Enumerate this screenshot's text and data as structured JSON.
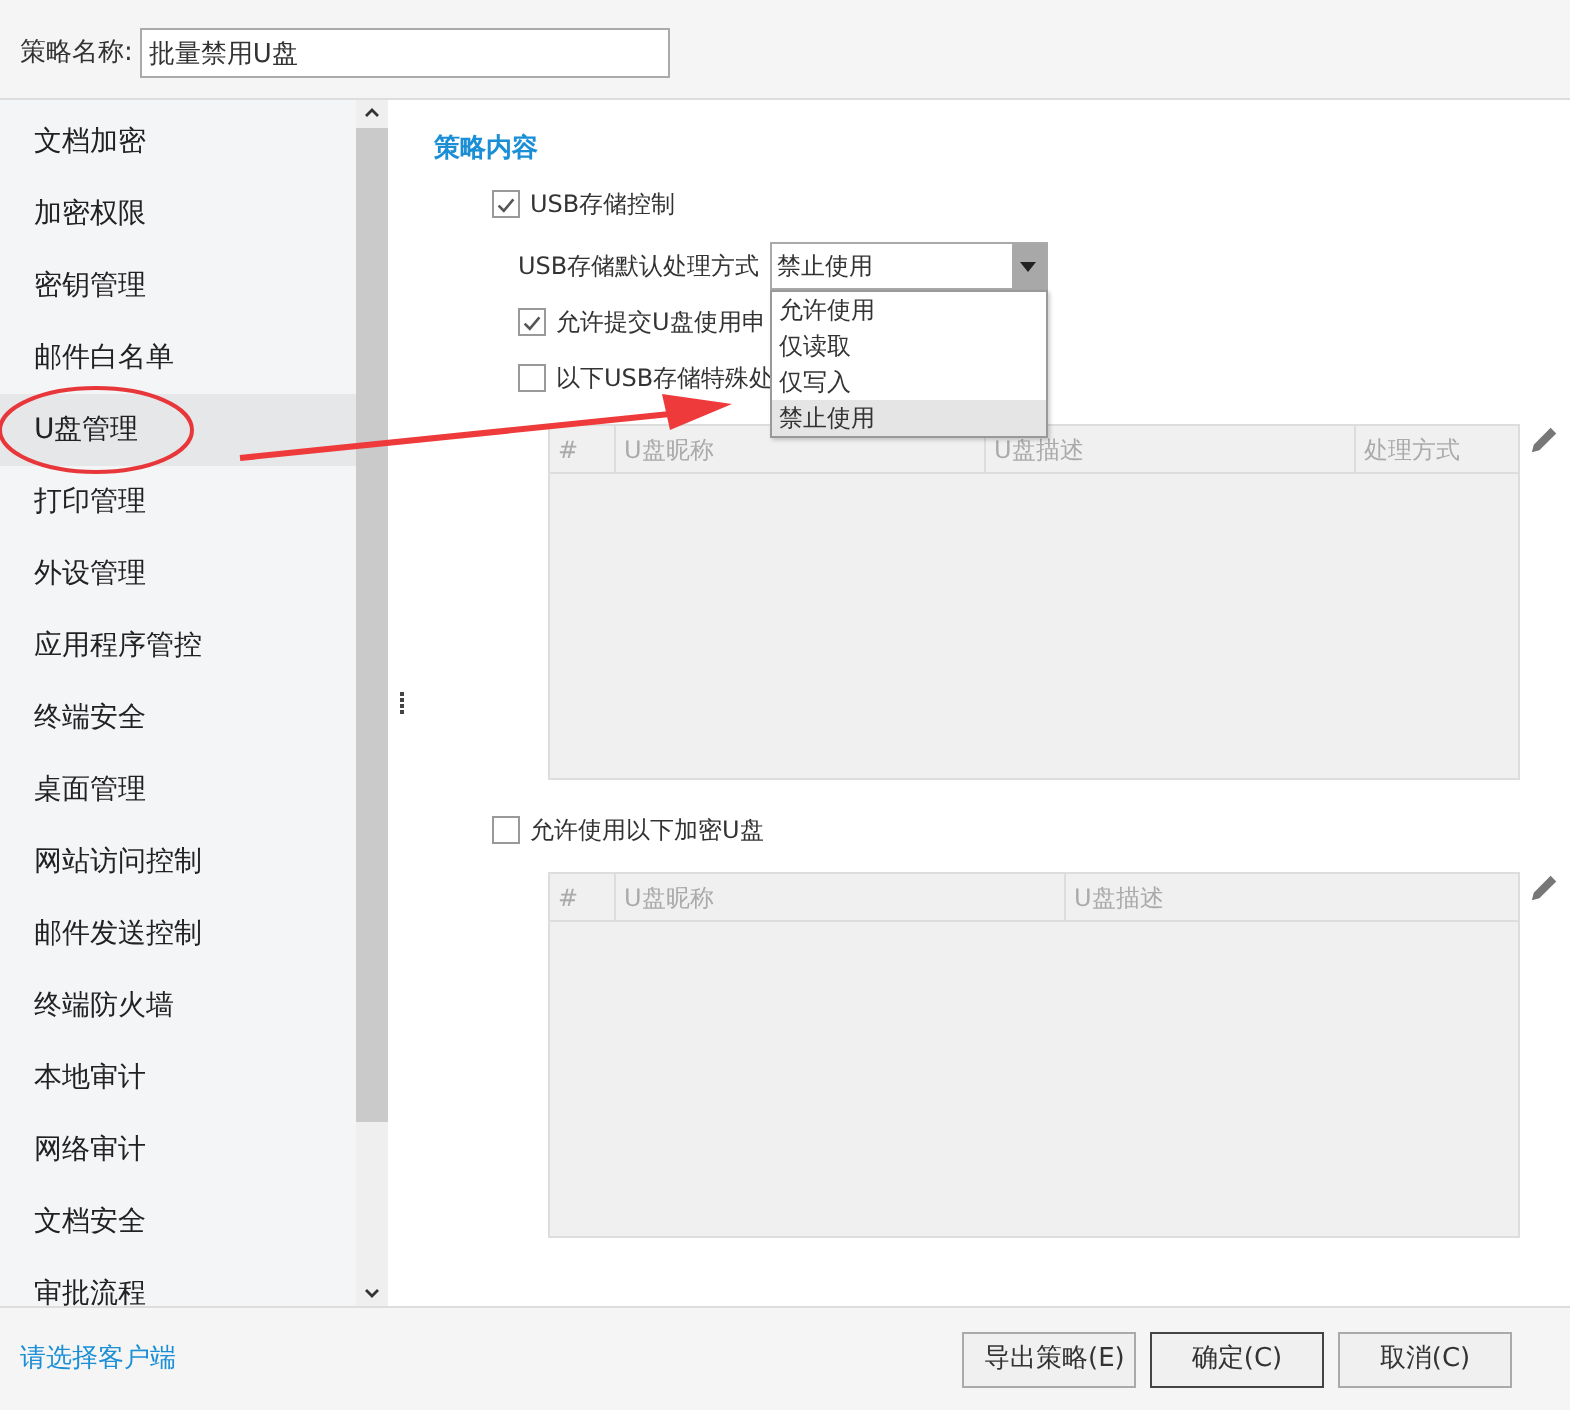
{
  "policy_name": {
    "label": "策略名称:",
    "value": "批量禁用U盘"
  },
  "sidebar": {
    "items": [
      {
        "label": "文档加密",
        "selected": false
      },
      {
        "label": "加密权限",
        "selected": false
      },
      {
        "label": "密钥管理",
        "selected": false
      },
      {
        "label": "邮件白名单",
        "selected": false
      },
      {
        "label": "U盘管理",
        "selected": true
      },
      {
        "label": "打印管理",
        "selected": false
      },
      {
        "label": "外设管理",
        "selected": false
      },
      {
        "label": "应用程序管控",
        "selected": false
      },
      {
        "label": "终端安全",
        "selected": false
      },
      {
        "label": "桌面管理",
        "selected": false
      },
      {
        "label": "网站访问控制",
        "selected": false
      },
      {
        "label": "邮件发送控制",
        "selected": false
      },
      {
        "label": "终端防火墙",
        "selected": false
      },
      {
        "label": "本地审计",
        "selected": false
      },
      {
        "label": "网络审计",
        "selected": false
      },
      {
        "label": "文档安全",
        "selected": false
      },
      {
        "label": "审批流程",
        "selected": false
      }
    ]
  },
  "section_title": "策略内容",
  "usb_control": {
    "label": "USB存储控制",
    "checked": true
  },
  "default_mode": {
    "label": "USB存储默认处理方式",
    "value": "禁止使用",
    "expanded": true,
    "options": [
      {
        "label": "允许使用",
        "selected": false
      },
      {
        "label": "仅读取",
        "selected": false
      },
      {
        "label": "仅写入",
        "selected": false
      },
      {
        "label": "禁止使用",
        "selected": true
      }
    ]
  },
  "allow_request": {
    "label": "允许提交U盘使用申",
    "checked": true
  },
  "special_usb": {
    "label": "以下USB存储特殊处",
    "checked": false,
    "table": {
      "columns": [
        "#",
        "U盘昵称",
        "U盘描述",
        "处理方式"
      ]
    }
  },
  "encrypted_usb": {
    "label": "允许使用以下加密U盘",
    "checked": false,
    "table": {
      "columns": [
        "#",
        "U盘昵称",
        "U盘描述"
      ]
    }
  },
  "footer": {
    "link": "请选择客户端",
    "buttons": [
      "导出策略(E)",
      "确定(C)",
      "取消(C)"
    ]
  }
}
